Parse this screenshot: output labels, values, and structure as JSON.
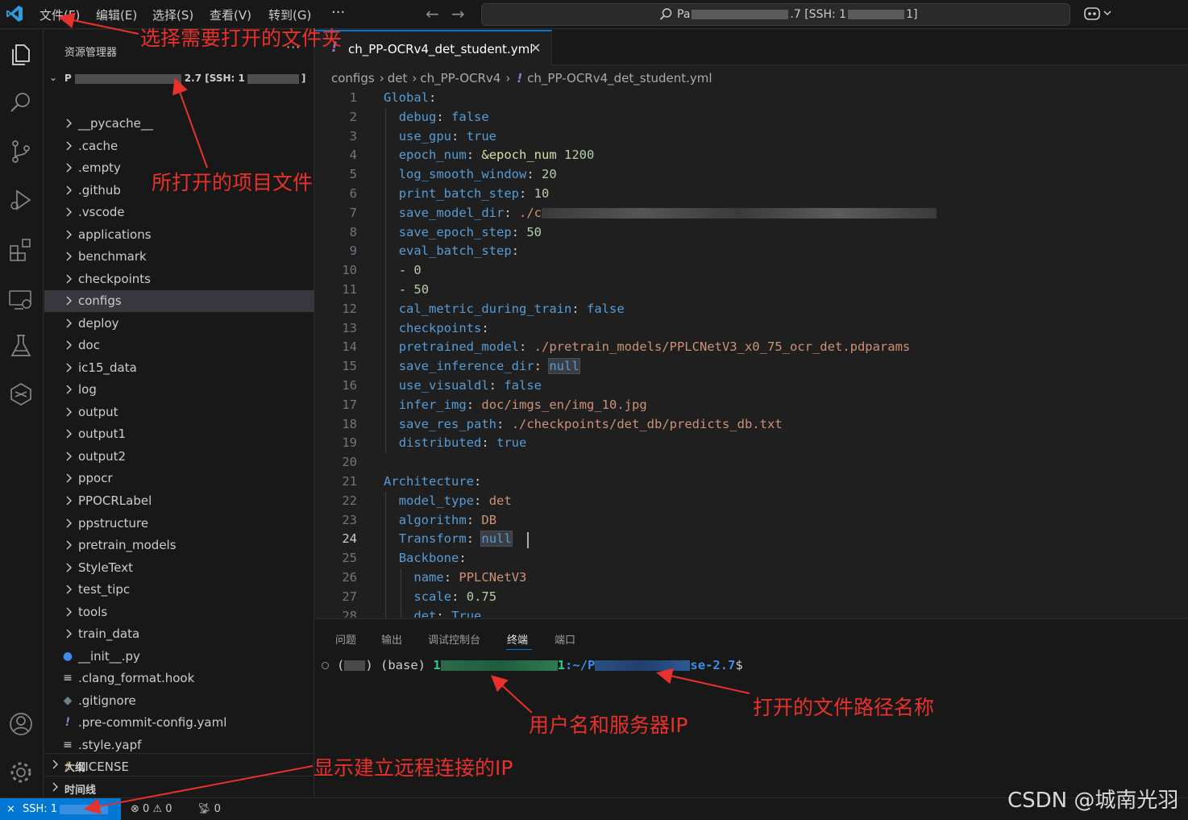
{
  "menu": {
    "file": "文件(F)",
    "edit": "编辑(E)",
    "selection": "选择(S)",
    "view": "查看(V)",
    "goto": "转到(G)",
    "more": "···"
  },
  "command_center": {
    "prefix": "Pa",
    "suffix": ".7 [SSH: 1",
    "end": "1]"
  },
  "sidebar": {
    "title": "资源管理器",
    "more": "···",
    "root_prefix": "P",
    "root_mid": "2.7 [SSH: 1",
    "root_end": "]",
    "items": [
      {
        "label": "__pycache__",
        "type": "folder"
      },
      {
        "label": ".cache",
        "type": "folder"
      },
      {
        "label": ".empty",
        "type": "folder"
      },
      {
        "label": ".github",
        "type": "folder"
      },
      {
        "label": ".vscode",
        "type": "folder"
      },
      {
        "label": "applications",
        "type": "folder"
      },
      {
        "label": "benchmark",
        "type": "folder"
      },
      {
        "label": "checkpoints",
        "type": "folder"
      },
      {
        "label": "configs",
        "type": "folder",
        "selected": true
      },
      {
        "label": "deploy",
        "type": "folder"
      },
      {
        "label": "doc",
        "type": "folder"
      },
      {
        "label": "ic15_data",
        "type": "folder"
      },
      {
        "label": "log",
        "type": "folder"
      },
      {
        "label": "output",
        "type": "folder"
      },
      {
        "label": "output1",
        "type": "folder"
      },
      {
        "label": "output2",
        "type": "folder"
      },
      {
        "label": "ppocr",
        "type": "folder"
      },
      {
        "label": "PPOCRLabel",
        "type": "folder"
      },
      {
        "label": "ppstructure",
        "type": "folder"
      },
      {
        "label": "pretrain_models",
        "type": "folder"
      },
      {
        "label": "StyleText",
        "type": "folder"
      },
      {
        "label": "test_tipc",
        "type": "folder"
      },
      {
        "label": "tools",
        "type": "folder"
      },
      {
        "label": "train_data",
        "type": "folder"
      },
      {
        "label": "__init__.py",
        "type": "python"
      },
      {
        "label": ".clang_format.hook",
        "type": "lines"
      },
      {
        "label": ".gitignore",
        "type": "git"
      },
      {
        "label": ".pre-commit-config.yaml",
        "type": "yaml"
      },
      {
        "label": ".style.yapf",
        "type": "lines"
      },
      {
        "label": "LICENSE",
        "type": "license"
      }
    ],
    "outline": "大纲",
    "timeline": "时间线"
  },
  "editor": {
    "tab_label": "ch_PP-OCRv4_det_student.yml",
    "tab_close": "✕",
    "breadcrumb": [
      "configs",
      "det",
      "ch_PP-OCRv4",
      "ch_PP-OCRv4_det_student.yml"
    ],
    "lines": [
      {
        "n": "1",
        "indent": 0,
        "key": "Global",
        "sep": ":",
        "val": "",
        "vt": ""
      },
      {
        "n": "2",
        "indent": 1,
        "key": "debug",
        "sep": ": ",
        "val": "false",
        "vt": "b"
      },
      {
        "n": "3",
        "indent": 1,
        "key": "use_gpu",
        "sep": ": ",
        "val": "true",
        "vt": "b"
      },
      {
        "n": "4",
        "indent": 1,
        "key": "epoch_num",
        "sep": ": ",
        "val": "&epoch_num",
        "vt": "anchor",
        "val2": " 1200"
      },
      {
        "n": "5",
        "indent": 1,
        "key": "log_smooth_window",
        "sep": ": ",
        "val": "20",
        "vt": "n"
      },
      {
        "n": "6",
        "indent": 1,
        "key": "print_batch_step",
        "sep": ": ",
        "val": "10",
        "vt": "n"
      },
      {
        "n": "7",
        "indent": 1,
        "key": "save_model_dir",
        "sep": ": ",
        "val": "./c",
        "vt": "v",
        "redact": true
      },
      {
        "n": "8",
        "indent": 1,
        "key": "save_epoch_step",
        "sep": ": ",
        "val": "50",
        "vt": "n"
      },
      {
        "n": "9",
        "indent": 1,
        "key": "eval_batch_step",
        "sep": ":",
        "val": "",
        "vt": ""
      },
      {
        "n": "10",
        "indent": 1,
        "key": "",
        "sep": "- ",
        "val": "0",
        "vt": "n"
      },
      {
        "n": "11",
        "indent": 1,
        "key": "",
        "sep": "- ",
        "val": "50",
        "vt": "n"
      },
      {
        "n": "12",
        "indent": 1,
        "key": "cal_metric_during_train",
        "sep": ": ",
        "val": "false",
        "vt": "b"
      },
      {
        "n": "13",
        "indent": 1,
        "key": "checkpoints",
        "sep": ":",
        "val": "",
        "vt": ""
      },
      {
        "n": "14",
        "indent": 1,
        "key": "pretrained_model",
        "sep": ": ",
        "val": "./pretrain_models/PPLCNetV3_x0_75_ocr_det.pdparams",
        "vt": "v"
      },
      {
        "n": "15",
        "indent": 1,
        "key": "save_inference_dir",
        "sep": ": ",
        "val": "null",
        "vt": "b",
        "hl": true
      },
      {
        "n": "16",
        "indent": 1,
        "key": "use_visualdl",
        "sep": ": ",
        "val": "false",
        "vt": "b"
      },
      {
        "n": "17",
        "indent": 1,
        "key": "infer_img",
        "sep": ": ",
        "val": "doc/imgs_en/img_10.jpg",
        "vt": "v"
      },
      {
        "n": "18",
        "indent": 1,
        "key": "save_res_path",
        "sep": ": ",
        "val": "./checkpoints/det_db/predicts_db.txt",
        "vt": "v"
      },
      {
        "n": "19",
        "indent": 1,
        "key": "distributed",
        "sep": ": ",
        "val": "true",
        "vt": "b"
      },
      {
        "n": "20",
        "indent": 0,
        "key": "",
        "sep": "",
        "val": "",
        "vt": ""
      },
      {
        "n": "21",
        "indent": 0,
        "key": "Architecture",
        "sep": ":",
        "val": "",
        "vt": ""
      },
      {
        "n": "22",
        "indent": 1,
        "key": "model_type",
        "sep": ": ",
        "val": "det",
        "vt": "v"
      },
      {
        "n": "23",
        "indent": 1,
        "key": "algorithm",
        "sep": ": ",
        "val": "DB",
        "vt": "v"
      },
      {
        "n": "24",
        "indent": 1,
        "key": "Transform",
        "sep": ": ",
        "val": "null",
        "vt": "b",
        "hl": true,
        "current": true
      },
      {
        "n": "25",
        "indent": 1,
        "key": "Backbone",
        "sep": ":",
        "val": "",
        "vt": ""
      },
      {
        "n": "26",
        "indent": 2,
        "key": "name",
        "sep": ": ",
        "val": "PPLCNetV3",
        "vt": "v"
      },
      {
        "n": "27",
        "indent": 2,
        "key": "scale",
        "sep": ": ",
        "val": "0.75",
        "vt": "n"
      },
      {
        "n": "28",
        "indent": 2,
        "key": "det",
        "sep": ": ",
        "val": "True",
        "vt": "b"
      }
    ]
  },
  "panel": {
    "tabs": [
      "问题",
      "输出",
      "调试控制台",
      "终端",
      "端口"
    ],
    "active_tab": "终端",
    "terminal": {
      "env_open": "(",
      "env_close": ")",
      "base": " (base) ",
      "user_start": "1",
      "user_end": "1",
      "path_start": ":~/P",
      "path_end": "se-2.7",
      "prompt": "$"
    }
  },
  "statusbar": {
    "remote": "SSH: 1",
    "errors": "0",
    "warnings": "0",
    "ports": "0"
  },
  "annotations": {
    "open_folder": "选择需要打开的文件夹",
    "project_files": "所打开的项目文件",
    "path_name": "打开的文件路径名称",
    "user_ip": "用户名和服务器IP",
    "remote_ip": "显示建立远程连接的IP"
  },
  "watermark": "CSDN @城南光羽",
  "colors": {
    "accent": "#0078d4",
    "annotation": "#e8312a",
    "key": "#569cd6",
    "string": "#ce9178",
    "number": "#b5cea8"
  }
}
